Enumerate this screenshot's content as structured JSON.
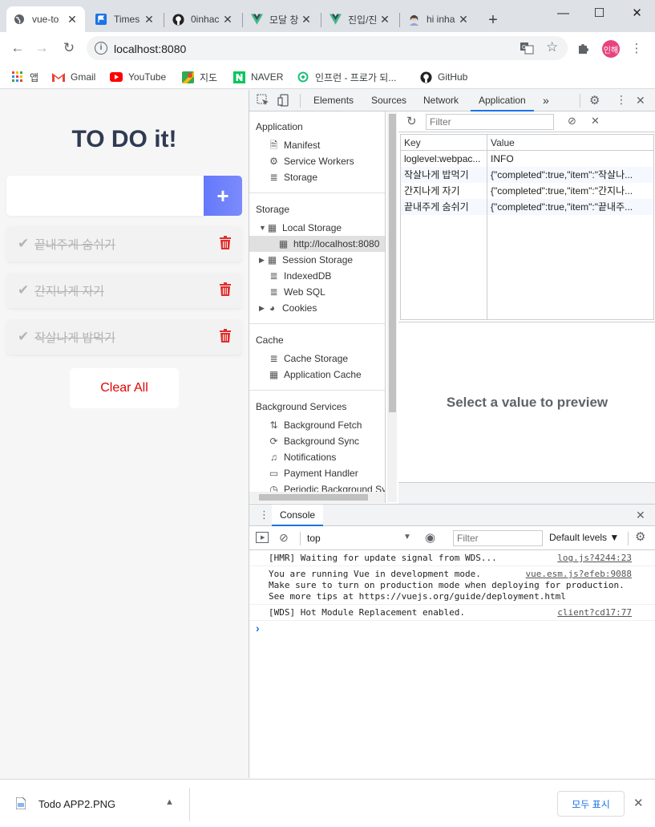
{
  "tabs": [
    {
      "label": "vue-to",
      "icon": "globe-icon",
      "active": true
    },
    {
      "label": "Times",
      "icon": "flag-icon",
      "active": false
    },
    {
      "label": "0inhac",
      "icon": "github-icon",
      "active": false
    },
    {
      "label": "모달 창",
      "icon": "vue-icon",
      "active": false
    },
    {
      "label": "진입/진",
      "icon": "vue-icon",
      "active": false
    },
    {
      "label": "hi inha",
      "icon": "avatar-icon",
      "active": false
    }
  ],
  "new_tab": "+",
  "address": "localhost:8080",
  "profile_badge": "인해",
  "bookmarks": [
    {
      "label": "앱",
      "icon": "apps-icon"
    },
    {
      "label": "Gmail",
      "icon": "gmail-icon"
    },
    {
      "label": "YouTube",
      "icon": "youtube-icon"
    },
    {
      "label": "지도",
      "icon": "maps-icon"
    },
    {
      "label": "NAVER",
      "icon": "naver-icon"
    },
    {
      "label": "인프런 - 프로가 되...",
      "icon": "inflearn-icon"
    },
    {
      "label": "GitHub",
      "icon": "github-icon"
    }
  ],
  "app": {
    "title": "TO DO it!",
    "input_value": "",
    "add_icon": "+",
    "todos": [
      {
        "text": "끝내주게 숨쉬기",
        "completed": true
      },
      {
        "text": "간지나게 자기",
        "completed": true
      },
      {
        "text": "작살나게 밥먹기",
        "completed": true
      }
    ],
    "clear_label": "Clear All"
  },
  "devtools": {
    "tabs": [
      "Elements",
      "Sources",
      "Network",
      "Application"
    ],
    "active_tab": "Application",
    "more": "»",
    "sidebar": {
      "application_header": "Application",
      "application_items": [
        "Manifest",
        "Service Workers",
        "Storage"
      ],
      "storage_header": "Storage",
      "storage_items": [
        "Local Storage",
        "http://localhost:8080",
        "Session Storage",
        "IndexedDB",
        "Web SQL",
        "Cookies"
      ],
      "cache_header": "Cache",
      "cache_items": [
        "Cache Storage",
        "Application Cache"
      ],
      "bg_header": "Background Services",
      "bg_items": [
        "Background Fetch",
        "Background Sync",
        "Notifications",
        "Payment Handler",
        "Periodic Background Sync"
      ]
    },
    "filter_placeholder": "Filter",
    "table": {
      "headers": [
        "Key",
        "Value"
      ],
      "rows": [
        {
          "key": "loglevel:webpac...",
          "value": "INFO"
        },
        {
          "key": "작살나게 밥먹기",
          "value": "{\"completed\":true,\"item\":\"작살나..."
        },
        {
          "key": "간지나게 자기",
          "value": "{\"completed\":true,\"item\":\"간지나..."
        },
        {
          "key": "끝내주게 숨쉬기",
          "value": "{\"completed\":true,\"item\":\"끝내주..."
        }
      ]
    },
    "preview_text": "Select a value to preview"
  },
  "console": {
    "tab": "Console",
    "context": "top",
    "filter_placeholder": "Filter",
    "levels": "Default levels ▼",
    "lines": [
      {
        "msg": "[HMR] Waiting for update signal from WDS...",
        "src": "log.js?4244:23"
      },
      {
        "msg": "You are running Vue in development mode.\nMake sure to turn on production mode when deploying for production.\nSee more tips at https://vuejs.org/guide/deployment.html",
        "src": "vue.esm.js?efeb:9088"
      },
      {
        "msg": "[WDS] Hot Module Replacement enabled.",
        "src": "client?cd17:77"
      }
    ],
    "prompt": "›"
  },
  "download": {
    "file": "Todo APP2.PNG",
    "show_all": "모두 표시"
  }
}
